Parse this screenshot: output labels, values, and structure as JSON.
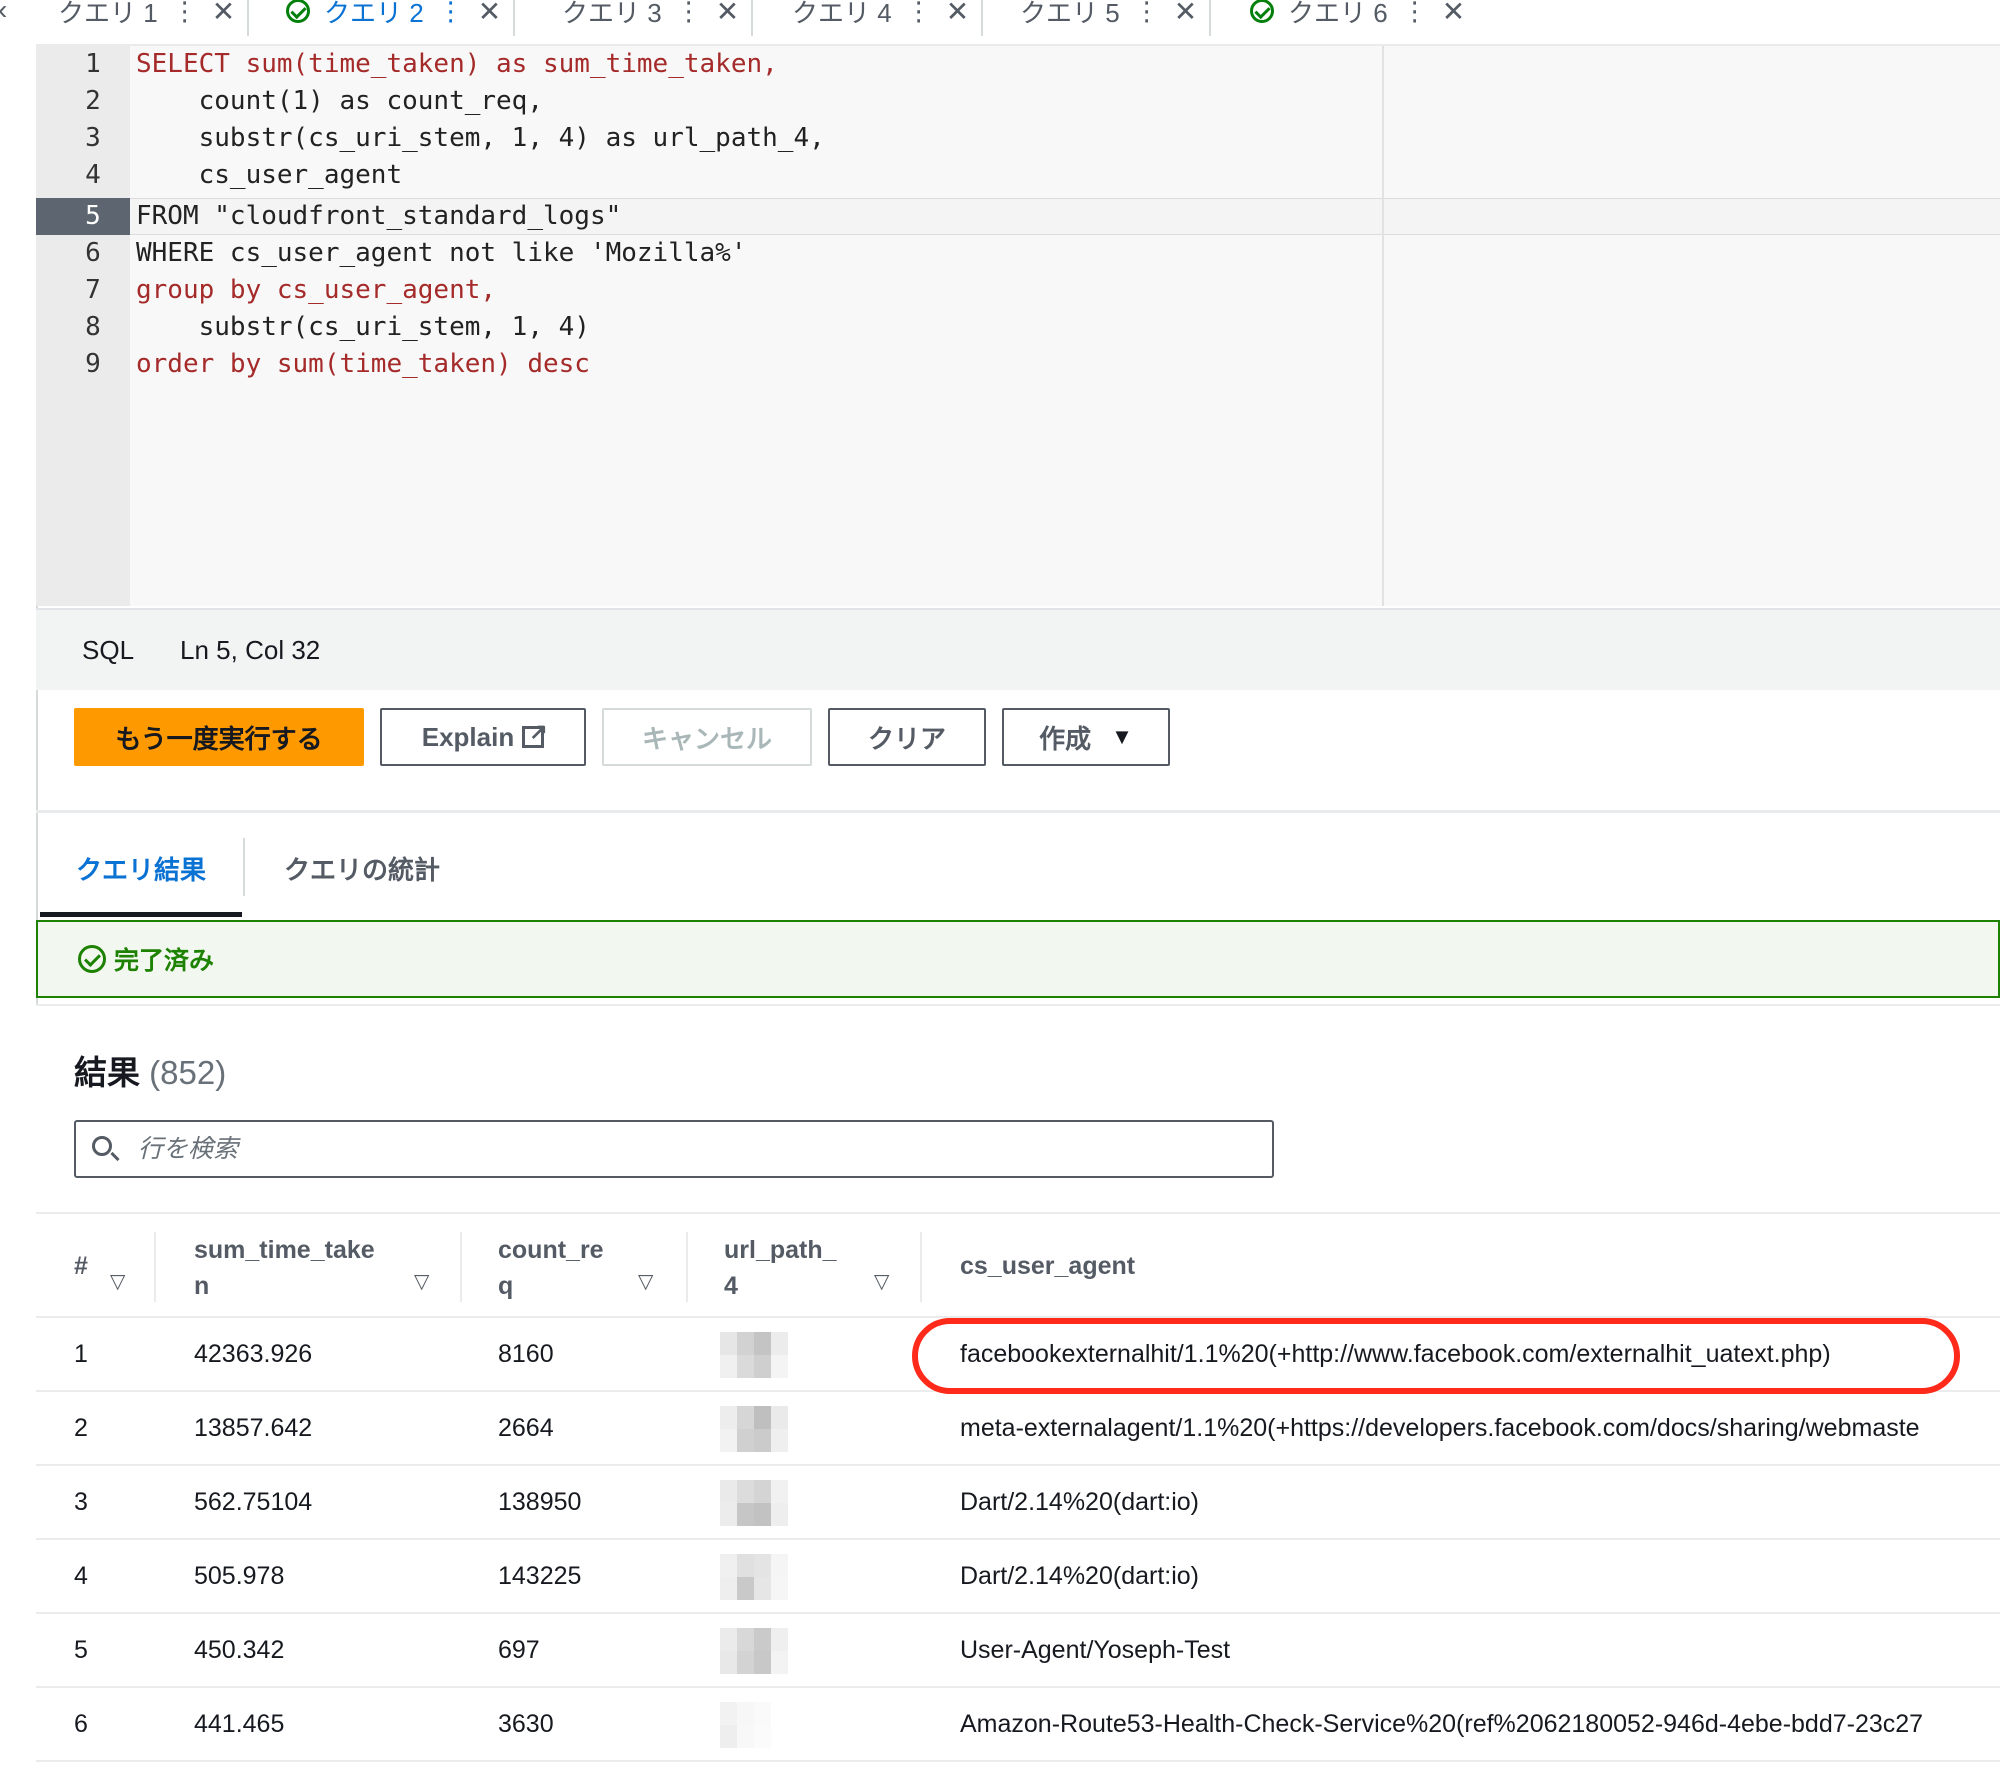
{
  "tabs": [
    {
      "label": "クエリ 1",
      "status": "none"
    },
    {
      "label": "クエリ 2",
      "status": "ok",
      "active": true
    },
    {
      "label": "クエリ 3",
      "status": "none"
    },
    {
      "label": "クエリ 4",
      "status": "none"
    },
    {
      "label": "クエリ 5",
      "status": "none"
    },
    {
      "label": "クエリ 6",
      "status": "ok"
    }
  ],
  "tab_more": "⋮",
  "tab_close": "✕",
  "editor": {
    "line_numbers": [
      "1",
      "2",
      "3",
      "4",
      "5",
      "6",
      "7",
      "8",
      "9"
    ],
    "current_line": 5,
    "lines": [
      "SELECT sum(time_taken) as sum_time_taken,",
      "    count(1) as count_req,",
      "    substr(cs_uri_stem, 1, 4) as url_path_4,",
      "    cs_user_agent",
      "FROM \"cloudfront_standard_logs\"",
      "WHERE cs_user_agent not like 'Mozilla%'",
      "group by cs_user_agent,",
      "    substr(cs_uri_stem, 1, 4)",
      "order by sum(time_taken) desc"
    ]
  },
  "status_bar": {
    "language": "SQL",
    "cursor": "Ln 5, Col 32"
  },
  "buttons": {
    "run_again": "もう一度実行する",
    "explain": "Explain",
    "cancel": "キャンセル",
    "clear": "クリア",
    "create": "作成"
  },
  "result_tabs": {
    "results": "クエリ結果",
    "stats": "クエリの統計"
  },
  "status": {
    "text": "完了済み"
  },
  "results": {
    "title": "結果",
    "count": "(852)",
    "search_placeholder": "行を検索",
    "columns": [
      "#",
      "sum_time_take\nn",
      "count_re\nq",
      "url_path_\n4",
      "cs_user_agent"
    ],
    "column_lines": [
      [
        "#"
      ],
      [
        "sum_time_take",
        "n"
      ],
      [
        "count_re",
        "q"
      ],
      [
        "url_path_",
        "4"
      ],
      [
        "cs_user_agent"
      ]
    ],
    "rows": [
      {
        "n": "1",
        "sum_time_taken": "42363.926",
        "count_req": "8160",
        "cs_user_agent": "facebookexternalhit/1.1%20(+http://www.facebook.com/externalhit_uatext.php)"
      },
      {
        "n": "2",
        "sum_time_taken": "13857.642",
        "count_req": "2664",
        "cs_user_agent": "meta-externalagent/1.1%20(+https://developers.facebook.com/docs/sharing/webmaste"
      },
      {
        "n": "3",
        "sum_time_taken": "562.75104",
        "count_req": "138950",
        "cs_user_agent": "Dart/2.14%20(dart:io)"
      },
      {
        "n": "4",
        "sum_time_taken": "505.978",
        "count_req": "143225",
        "cs_user_agent": "Dart/2.14%20(dart:io)"
      },
      {
        "n": "5",
        "sum_time_taken": "450.342",
        "count_req": "697",
        "cs_user_agent": "User-Agent/Yoseph-Test"
      },
      {
        "n": "6",
        "sum_time_taken": "441.465",
        "count_req": "3630",
        "cs_user_agent": "Amazon-Route53-Health-Check-Service%20(ref%2062180052-946d-4ebe-bdd7-23c27"
      }
    ]
  },
  "colors": {
    "accent": "#0972d3",
    "primary_button": "#ff9900",
    "success": "#1d8102",
    "annotation": "#ff2a1a"
  },
  "icons": [
    "check-circle-icon",
    "close-icon",
    "more-vertical-icon",
    "external-link-icon",
    "caret-down-icon",
    "search-icon",
    "sort-icon",
    "chevron-left-icon"
  ]
}
